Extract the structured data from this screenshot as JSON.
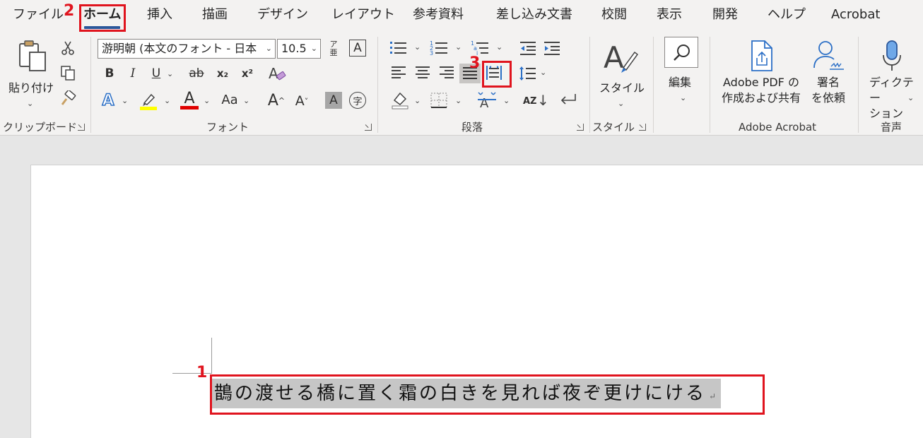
{
  "tabs": [
    "ファイル",
    "ホーム",
    "挿入",
    "描画",
    "デザイン",
    "レイアウト",
    "参考資料",
    "差し込み文書",
    "校閲",
    "表示",
    "開発",
    "ヘルプ",
    "Acrobat"
  ],
  "active_tab": "ホーム",
  "clipboard": {
    "paste_label": "貼り付け",
    "group_label": "クリップボード"
  },
  "font": {
    "font_name": "游明朝 (本文のフォント - 日本",
    "font_size": "10.5",
    "bold": "B",
    "italic": "I",
    "underline": "U",
    "strike": "ab",
    "subscript": "x₂",
    "superscript": "x²",
    "text_effects": "A",
    "font_color": "A",
    "change_case": "Aa",
    "grow": "A",
    "shrink": "A",
    "char_shading": "A",
    "enclose": "字",
    "phonetic": "ア",
    "border": "A",
    "group_label": "フォント"
  },
  "paragraph": {
    "sort": "AZ",
    "group_label": "段落"
  },
  "styles": {
    "label": "スタイル",
    "group_label": "スタイル"
  },
  "editing": {
    "label": "編集"
  },
  "acrobat": {
    "create_share": "Adobe PDF の\n作成および共有",
    "sign_request": "署名\nを依頼",
    "group_label": "Adobe Acrobat"
  },
  "voice": {
    "dictate": "ディクテー\nション",
    "group_label": "音声"
  },
  "document": {
    "text": "鵲の渡せる橋に置く霜の白きを見れば夜ぞ更けにける",
    "para_mark": "↵"
  },
  "annotations": {
    "step1": "1",
    "step2": "2",
    "step3": "3"
  },
  "colors": {
    "accent": "#2b579a",
    "highlight": "#ffff00",
    "font_color": "#e00000",
    "annotation": "#e0141e"
  }
}
